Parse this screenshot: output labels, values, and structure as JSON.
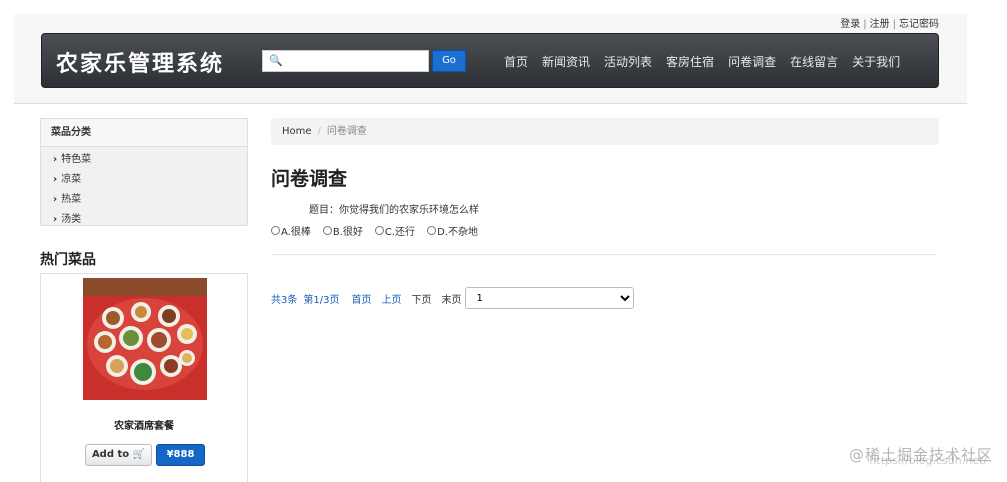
{
  "top_links": {
    "login": "登录",
    "register": "注册",
    "forgot": "忘记密码"
  },
  "header": {
    "brand": "农家乐管理系统",
    "search_placeholder": "",
    "go_label": "Go",
    "nav": [
      "首页",
      "新闻资讯",
      "活动列表",
      "客房住宿",
      "问卷调查",
      "在线留言",
      "关于我们"
    ]
  },
  "sidebar": {
    "category_title": "菜品分类",
    "categories": [
      "特色菜",
      "凉菜",
      "热菜",
      "汤类"
    ],
    "hot_title": "热门菜品",
    "hot_item": {
      "name": "农家酒席套餐",
      "add_label": "Add to",
      "price": "¥888"
    }
  },
  "breadcrumb": {
    "home": "Home",
    "current": "问卷调查"
  },
  "survey": {
    "title": "问卷调查",
    "question": "题目：你觉得我们的农家乐环境怎么样",
    "options": [
      "A.很棒",
      "B.很好",
      "C.还行",
      "D.不杂地"
    ]
  },
  "pager": {
    "total": "共3条",
    "page": "第1/3页",
    "first": "首页",
    "prev": "上页",
    "next": "下页",
    "last": "末页",
    "selected": "1"
  },
  "watermark": {
    "text": "@稀土掘金技术社区",
    "url": "https://blog.csdn.net/"
  },
  "colors": {
    "nav_bg": "#3a3d42",
    "go_button": "#1a6fd0",
    "price_button": "#1466c7",
    "link": "#1a5fb4"
  }
}
